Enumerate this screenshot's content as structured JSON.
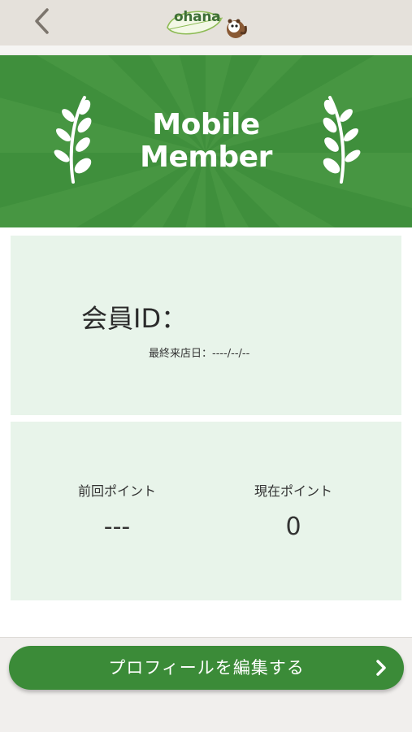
{
  "header": {
    "back_icon": "chevron-left-icon",
    "logo_text": "ohana",
    "logo_icon": "raccoon-mascot-icon"
  },
  "hero": {
    "title_line1": "Mobile",
    "title_line2": "Member",
    "left_icon": "laurel-branch-icon",
    "right_icon": "laurel-branch-icon"
  },
  "member": {
    "id_label": "会員ID：",
    "last_visit_label": "最終来店日：----/--/--"
  },
  "points": {
    "previous_label": "前回ポイント",
    "previous_value": "---",
    "current_label": "現在ポイント",
    "current_value": "0"
  },
  "footer": {
    "edit_profile_label": "プロフィールを編集する",
    "edit_profile_icon": "chevron-right-icon"
  },
  "colors": {
    "brand_green": "#3f8f3c",
    "card_bg": "#e8f4ea",
    "top_bar": "#e5e1db"
  }
}
